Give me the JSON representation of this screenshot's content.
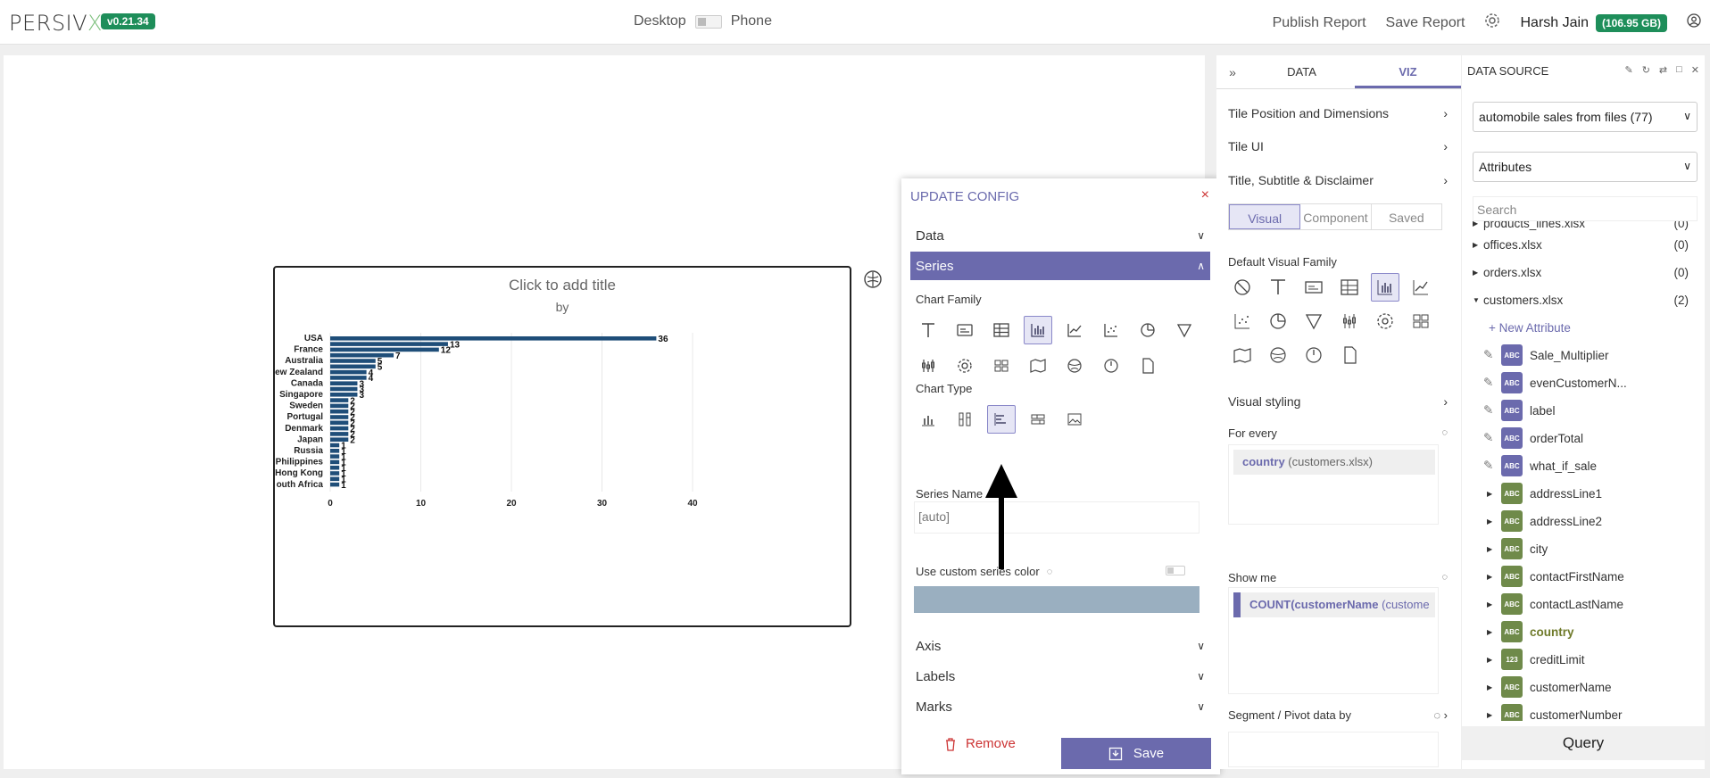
{
  "topbar": {
    "brand_main": "PERSIV",
    "brand_x": "X",
    "version": "v0.21.34",
    "device_desktop": "Desktop",
    "device_phone": "Phone",
    "publish": "Publish Report",
    "save_report": "Save Report",
    "user": "Harsh Jain",
    "quota": "(106.95 GB)"
  },
  "chart": {
    "title": "Click to add title",
    "subtitle": "by"
  },
  "chart_data": {
    "type": "bar",
    "orientation": "horizontal",
    "title": "Click to add title",
    "subtitle": "by",
    "categories": [
      "USA",
      "France",
      "Australia",
      "New Zealand",
      "Canada",
      "Singapore",
      "Sweden",
      "Portugal",
      "Denmark",
      "Japan",
      "Russia",
      "Philippines",
      "Hong Kong",
      "South Africa"
    ],
    "category_labels": [
      "USA",
      "France",
      "Australia",
      "ew Zealand",
      "Canada",
      "Singapore",
      "Sweden",
      "Portugal",
      "Denmark",
      "Japan",
      "Russia",
      "Philippines",
      "Hong Kong",
      "outh Africa"
    ],
    "values": [
      36,
      13,
      12,
      7,
      5,
      5,
      4,
      4,
      3,
      3,
      3,
      2,
      2,
      2,
      2,
      2,
      2,
      2,
      2,
      1,
      1,
      1,
      1,
      1,
      1,
      1,
      1
    ],
    "x_ticks": [
      "0",
      "10",
      "20",
      "30",
      "40"
    ],
    "xlim": [
      0,
      40
    ],
    "grid": true,
    "bar_color": "#1f4e79"
  },
  "config": {
    "title": "UPDATE CONFIG",
    "close": "×",
    "sections": {
      "data": "Data",
      "series": "Series",
      "axis": "Axis",
      "labels": "Labels",
      "marks": "Marks"
    },
    "chart_family_label": "Chart Family",
    "chart_type_label": "Chart Type",
    "series_name_label": "Series Name",
    "series_name_value": "[auto]",
    "custom_color_label": "Use custom series color",
    "swatch_color": "#9aafc0",
    "remove": "Remove",
    "save": "Save"
  },
  "viz": {
    "tab_data": "DATA",
    "tab_viz": "VIZ",
    "tile_position": "Tile Position and Dimensions",
    "tile_ui": "Tile UI",
    "title_subtitle": "Title, Subtitle & Disclaimer",
    "visual_tabs": [
      "Visual",
      "Component",
      "Saved"
    ],
    "default_family": "Default Visual Family",
    "visual_styling": "Visual styling",
    "for_every": "For every",
    "for_every_field": "country",
    "for_every_source": "(customers.xlsx)",
    "show_me": "Show me",
    "show_me_field": "COUNT(customerName",
    "show_me_source": "(custome",
    "segment": "Segment / Pivot data by"
  },
  "datasource": {
    "title": "DATA SOURCE",
    "source_select": "automobile sales from files (77)",
    "attr_select": "Attributes",
    "search_placeholder": "Search",
    "files": [
      {
        "name": "products_lines.xlsx",
        "count": "(0)"
      },
      {
        "name": "offices.xlsx",
        "count": "(0)"
      },
      {
        "name": "orders.xlsx",
        "count": "(0)"
      },
      {
        "name": "customers.xlsx",
        "count": "(2)"
      }
    ],
    "new_attribute": "+ New Attribute",
    "custom_attrs": [
      "Sale_Multiplier",
      "evenCustomerN...",
      "label",
      "orderTotal",
      "what_if_sale"
    ],
    "fields": [
      {
        "type": "ABC",
        "name": "addressLine1"
      },
      {
        "type": "ABC",
        "name": "addressLine2"
      },
      {
        "type": "ABC",
        "name": "city"
      },
      {
        "type": "ABC",
        "name": "contactFirstName"
      },
      {
        "type": "ABC",
        "name": "contactLastName"
      },
      {
        "type": "ABC",
        "name": "country"
      },
      {
        "type": "123",
        "name": "creditLimit"
      },
      {
        "type": "ABC",
        "name": "customerName"
      },
      {
        "type": "ABC",
        "name": "customerNumber"
      }
    ],
    "query": "Query"
  }
}
